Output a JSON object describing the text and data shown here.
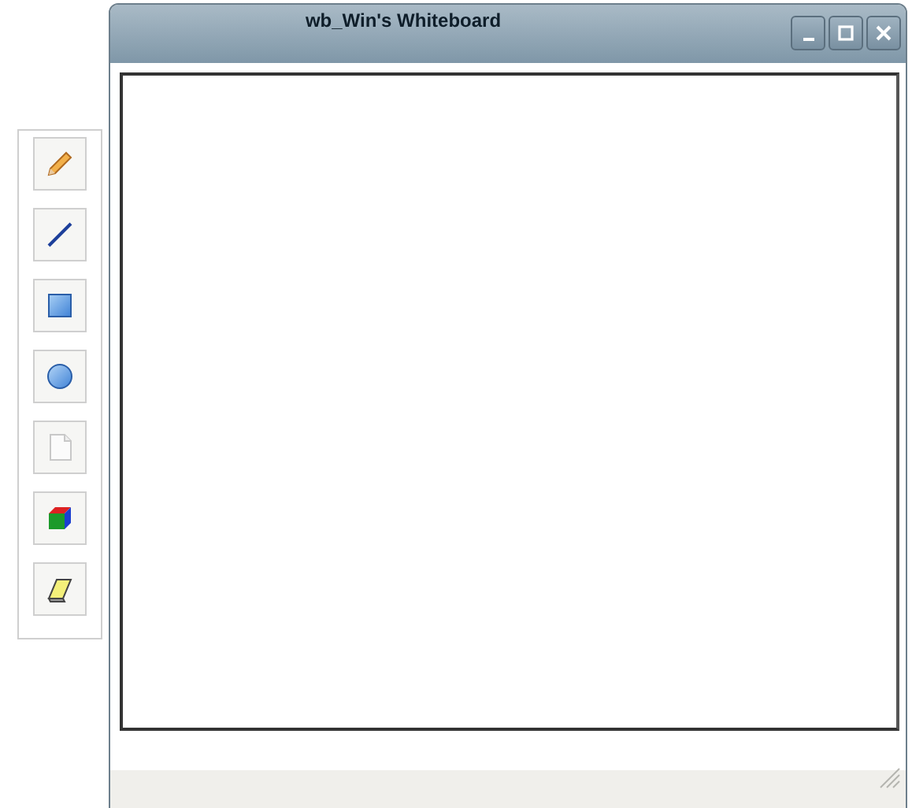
{
  "window": {
    "title": "wb_Win's Whiteboard"
  },
  "tools": [
    {
      "kind": "pencil"
    },
    {
      "kind": "line"
    },
    {
      "kind": "rectangle"
    },
    {
      "kind": "ellipse"
    },
    {
      "kind": "page"
    },
    {
      "kind": "cube"
    },
    {
      "kind": "eraser"
    }
  ]
}
